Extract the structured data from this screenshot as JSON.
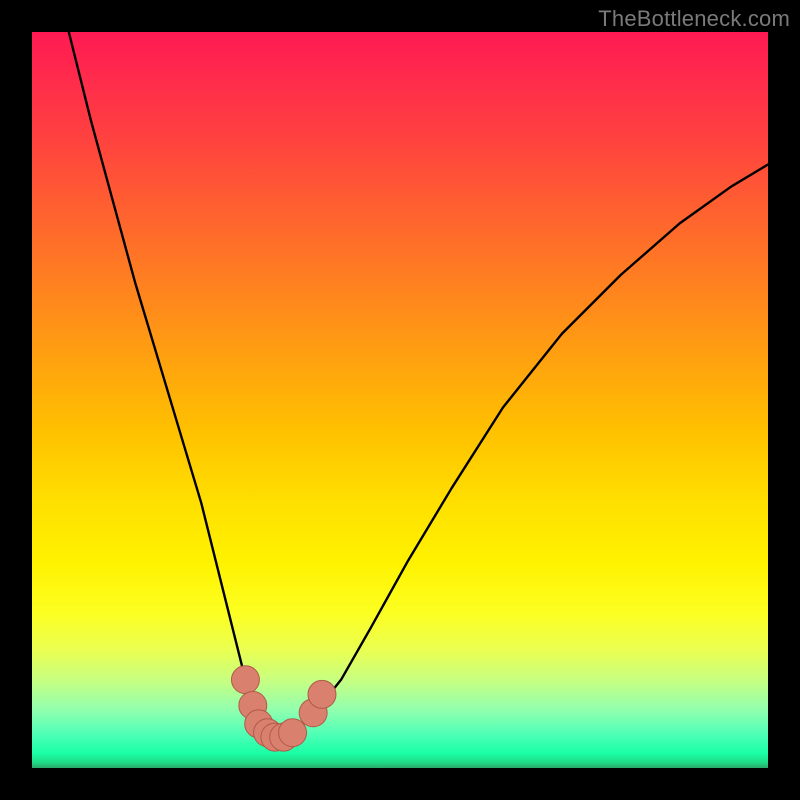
{
  "watermark": "TheBottleneck.com",
  "colors": {
    "frame": "#000000",
    "curve": "#000000",
    "marker_fill": "#d9816e",
    "marker_stroke": "#b15a4a",
    "gradient_stops": [
      "#ff1a52",
      "#ff2a4c",
      "#ff4040",
      "#ff6030",
      "#ff8020",
      "#ffa010",
      "#ffc000",
      "#ffe000",
      "#fff200",
      "#fcff22",
      "#eaff52",
      "#c8ff80",
      "#93ffae",
      "#4dffb6",
      "#1affa6",
      "#20d884",
      "#2aa868"
    ]
  },
  "chart_data": {
    "type": "line",
    "title": "",
    "xlabel": "",
    "ylabel": "",
    "xlim": [
      0,
      100
    ],
    "ylim": [
      0,
      100
    ],
    "grid": false,
    "legend": false,
    "note": "Axes are normalized 0–100; no tick labels are rendered in the source image, so values are positional estimates.",
    "series": [
      {
        "name": "curve",
        "x": [
          5,
          8,
          11,
          14,
          17,
          20,
          23,
          25,
          27,
          29,
          30.5,
          32,
          33.5,
          35,
          38,
          42,
          46,
          51,
          57,
          64,
          72,
          80,
          88,
          95,
          100
        ],
        "y": [
          100,
          88,
          77,
          66,
          56,
          46,
          36,
          28,
          20,
          12,
          7,
          4.5,
          4,
          4.5,
          7,
          12,
          19,
          28,
          38,
          49,
          59,
          67,
          74,
          79,
          82
        ]
      }
    ],
    "markers": [
      {
        "name": "left-cluster-top",
        "x": 29.0,
        "y": 12.0,
        "r": 1.9
      },
      {
        "name": "left-cluster-mid",
        "x": 30.0,
        "y": 8.5,
        "r": 1.9
      },
      {
        "name": "left-cluster-low1",
        "x": 30.8,
        "y": 6.0,
        "r": 1.9
      },
      {
        "name": "left-cluster-low2",
        "x": 32.0,
        "y": 4.8,
        "r": 1.9
      },
      {
        "name": "trough-1",
        "x": 33.0,
        "y": 4.2,
        "r": 1.9
      },
      {
        "name": "trough-2",
        "x": 34.2,
        "y": 4.2,
        "r": 1.9
      },
      {
        "name": "trough-3",
        "x": 35.4,
        "y": 4.8,
        "r": 1.9
      },
      {
        "name": "right-cluster-low",
        "x": 38.2,
        "y": 7.5,
        "r": 1.9
      },
      {
        "name": "right-cluster-high",
        "x": 39.4,
        "y": 10.0,
        "r": 1.9
      }
    ]
  }
}
